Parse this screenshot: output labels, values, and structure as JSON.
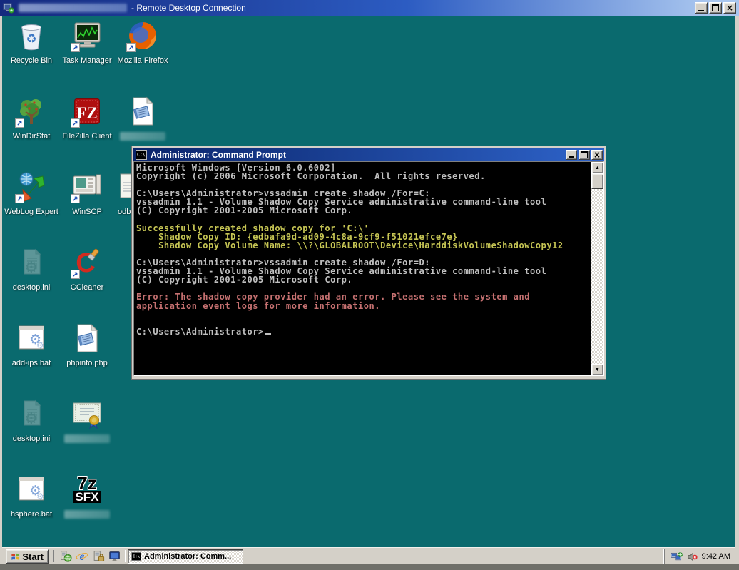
{
  "rdp_client": {
    "title": "- Remote Desktop Connection",
    "title_prefix_redacted": true,
    "window_buttons": {
      "minimize": "minimize",
      "maximize": "maximize",
      "close": "close"
    }
  },
  "desktop": {
    "background_color": "#0A6A6E",
    "icons": [
      {
        "name": "recycle-bin",
        "label": "Recycle Bin",
        "kind": "recycle-bin",
        "col": 1,
        "row": 1,
        "shortcut": false,
        "redacted": false
      },
      {
        "name": "task-manager",
        "label": "Task Manager",
        "kind": "task-manager",
        "col": 2,
        "row": 1,
        "shortcut": true,
        "redacted": false
      },
      {
        "name": "mozilla-firefox",
        "label": "Mozilla Firefox",
        "kind": "firefox",
        "col": 3,
        "row": 1,
        "shortcut": true,
        "redacted": false
      },
      {
        "name": "windirstat",
        "label": "WinDirStat",
        "kind": "windirstat",
        "col": 1,
        "row": 2,
        "shortcut": true,
        "redacted": false
      },
      {
        "name": "filezilla-client",
        "label": "FileZilla Client",
        "kind": "filezilla",
        "col": 2,
        "row": 2,
        "shortcut": true,
        "redacted": false
      },
      {
        "name": "redacted-document",
        "label": "",
        "kind": "notepad-doc",
        "col": 3,
        "row": 2,
        "shortcut": false,
        "redacted": true
      },
      {
        "name": "weblog-expert",
        "label": "WebLog Expert",
        "kind": "weblog",
        "col": 1,
        "row": 3,
        "shortcut": true,
        "redacted": false
      },
      {
        "name": "winscp",
        "label": "WinSCP",
        "kind": "winscp",
        "col": 2,
        "row": 3,
        "shortcut": true,
        "redacted": false
      },
      {
        "name": "odb-file",
        "label": "odb",
        "kind": "odb-partial",
        "col": 3,
        "row": 3,
        "shortcut": false,
        "redacted": false,
        "partial": true
      },
      {
        "name": "desktop-ini-1",
        "label": "desktop.ini",
        "kind": "ini-file",
        "col": 1,
        "row": 4,
        "shortcut": false,
        "redacted": false
      },
      {
        "name": "ccleaner",
        "label": "CCleaner",
        "kind": "ccleaner",
        "col": 2,
        "row": 4,
        "shortcut": true,
        "redacted": false
      },
      {
        "name": "add-ips-bat",
        "label": "add-ips.bat",
        "kind": "bat-file",
        "col": 1,
        "row": 5,
        "shortcut": false,
        "redacted": false
      },
      {
        "name": "phpinfo-php",
        "label": "phpinfo.php",
        "kind": "notepad-doc",
        "col": 2,
        "row": 5,
        "shortcut": false,
        "redacted": false
      },
      {
        "name": "desktop-ini-2",
        "label": "desktop.ini",
        "kind": "ini-file",
        "col": 1,
        "row": 6,
        "shortcut": false,
        "redacted": false
      },
      {
        "name": "certificate",
        "label": "",
        "kind": "certificate",
        "col": 2,
        "row": 6,
        "shortcut": false,
        "redacted": true
      },
      {
        "name": "hsphere-bat",
        "label": "hsphere.bat",
        "kind": "bat-file",
        "col": 1,
        "row": 7,
        "shortcut": false,
        "redacted": false
      },
      {
        "name": "7z-sfx",
        "label": "",
        "kind": "7z-sfx",
        "col": 2,
        "row": 7,
        "shortcut": false,
        "redacted": true
      }
    ]
  },
  "cmd_window": {
    "title": "Administrator: Command Prompt",
    "cursor_visible": true,
    "text_colors": {
      "normal": "#C0C0C0",
      "success": "#C6C554",
      "error": "#C67171",
      "background": "#000000"
    },
    "lines": [
      {
        "t": "Microsoft Windows [Version 6.0.6002]",
        "c": "normal"
      },
      {
        "t": "Copyright (c) 2006 Microsoft Corporation.  All rights reserved.",
        "c": "normal"
      },
      {
        "t": "",
        "c": "normal"
      },
      {
        "t": "C:\\Users\\Administrator>vssadmin create shadow /For=C:",
        "c": "normal"
      },
      {
        "t": "vssadmin 1.1 - Volume Shadow Copy Service administrative command-line tool",
        "c": "normal"
      },
      {
        "t": "(C) Copyright 2001-2005 Microsoft Corp.",
        "c": "normal"
      },
      {
        "t": "",
        "c": "normal"
      },
      {
        "t": "Successfully created shadow copy for 'C:\\'",
        "c": "success"
      },
      {
        "t": "    Shadow Copy ID: {edbafa9d-ad09-4c8a-9cf9-f51021efce7e}",
        "c": "success"
      },
      {
        "t": "    Shadow Copy Volume Name: \\\\?\\GLOBALROOT\\Device\\HarddiskVolumeShadowCopy12",
        "c": "success"
      },
      {
        "t": "",
        "c": "normal"
      },
      {
        "t": "C:\\Users\\Administrator>vssadmin create shadow /For=D:",
        "c": "normal"
      },
      {
        "t": "vssadmin 1.1 - Volume Shadow Copy Service administrative command-line tool",
        "c": "normal"
      },
      {
        "t": "(C) Copyright 2001-2005 Microsoft Corp.",
        "c": "normal"
      },
      {
        "t": "",
        "c": "normal"
      },
      {
        "t": "Error: The shadow copy provider had an error. Please see the system and",
        "c": "error"
      },
      {
        "t": "application event logs for more information.",
        "c": "error"
      },
      {
        "t": "",
        "c": "normal"
      },
      {
        "t": "",
        "c": "normal"
      },
      {
        "t": "C:\\Users\\Administrator>",
        "c": "normal"
      }
    ]
  },
  "taskbar": {
    "start_label": "Start",
    "quick_launch": [
      {
        "name": "windows-update"
      },
      {
        "name": "internet-explorer"
      },
      {
        "name": "server-security"
      },
      {
        "name": "remote-desktop"
      }
    ],
    "task_buttons": [
      {
        "label": "Administrator: Comm...",
        "active": true
      }
    ],
    "tray": {
      "icons": [
        {
          "name": "network"
        },
        {
          "name": "volume-muted"
        }
      ],
      "clock": "9:42 AM"
    }
  }
}
